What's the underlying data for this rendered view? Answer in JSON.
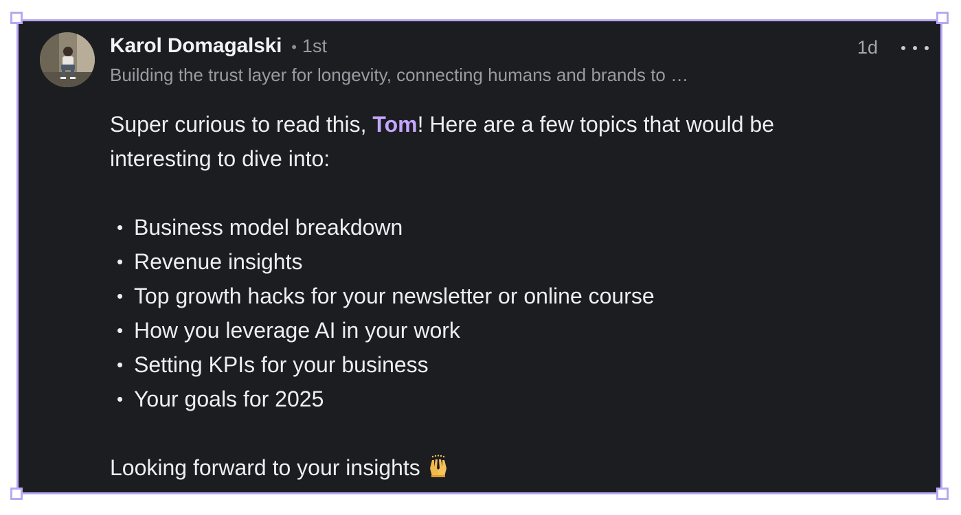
{
  "comment": {
    "author_name": "Karol Domagalski",
    "degree_separator": "•",
    "degree": "1st",
    "headline": "Building the trust layer for longevity, connecting humans and brands to …",
    "timestamp": "1d",
    "body_intro_before": "Super curious to read this, ",
    "mention": "Tom",
    "body_intro_after": "! Here are a few topics that would be interesting to dive into:",
    "bullet_char": "•",
    "topics": [
      "Business model breakdown",
      "Revenue insights",
      "Top growth hacks for your newsletter or online course",
      "How you leverage AI in your work",
      "Setting KPIs for your business",
      "Your goals for 2025"
    ],
    "closing": "Looking forward to your insights",
    "closing_emoji": "raising-hands-emoji"
  },
  "icons": {
    "more": "more-horizontal-icon",
    "avatar": "avatar-photo"
  },
  "colors": {
    "background": "#1c1d21",
    "selection_border": "#b9a7f5",
    "mention": "#c4a6ff",
    "primary_text": "#eeeef0",
    "secondary_text": "#9a9ba2"
  }
}
